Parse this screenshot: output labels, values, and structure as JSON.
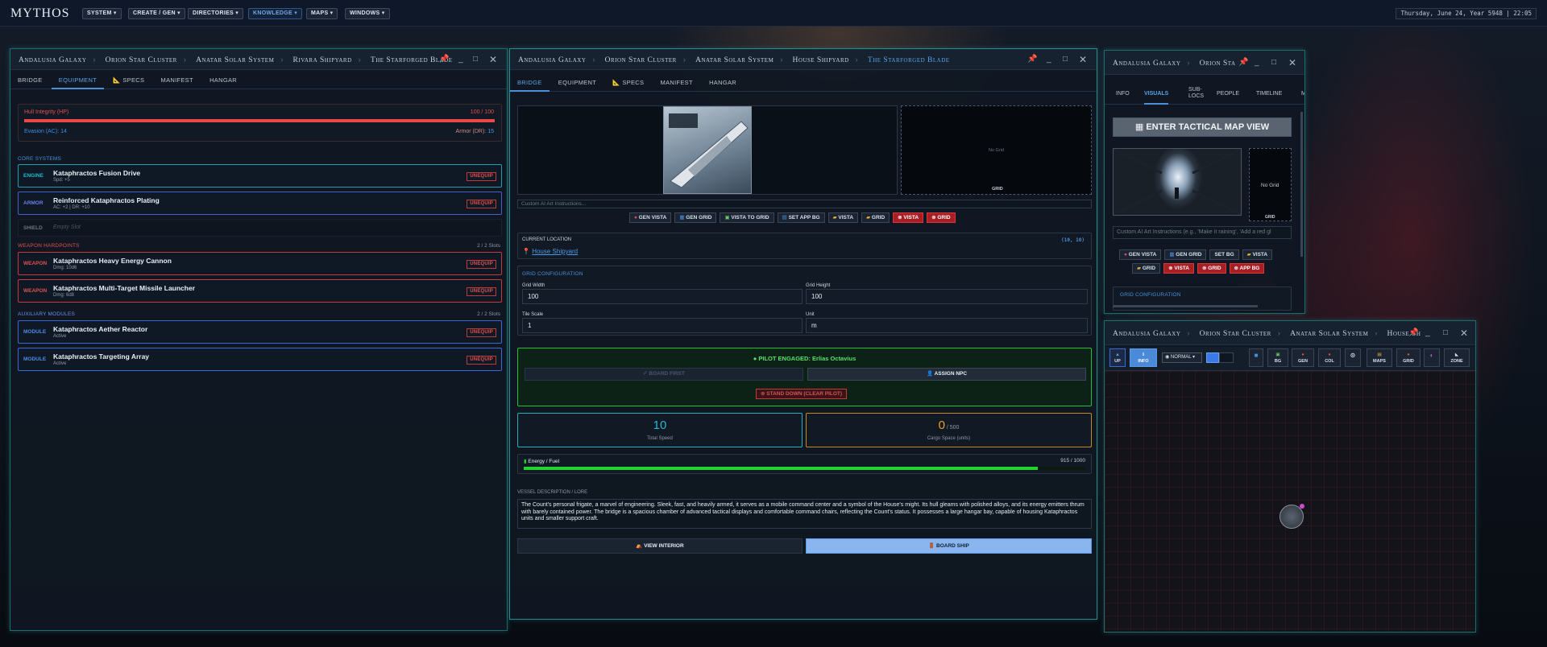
{
  "topbar": {
    "logo": "MYTHOS",
    "menus": [
      "SYSTEM ▾",
      "CREATE / GEN ▾",
      "DIRECTORIES ▾",
      "KNOWLEDGE ▾",
      "MAPS ▾",
      "WINDOWS ▾"
    ],
    "clock": "Thursday, June 24, Year 5948 | 22:05"
  },
  "win1": {
    "crumbs": [
      "Andalusia Galaxy",
      "Orion Star Cluster",
      "Anatar Solar System",
      "Rivara Shipyard",
      "The Starforged Blade"
    ],
    "tabs": [
      "BRIDGE",
      "EQUIPMENT",
      "SPECS",
      "MANIFEST",
      "HANGAR"
    ],
    "hull": {
      "label": "Hull Integrity (HP)",
      "value": "100 / 100",
      "fraction": 1.0
    },
    "evasion": "Evasion (AC): 14",
    "armor_label": "Armor (DR):",
    "armor_val": "15",
    "core_title": "CORE SYSTEMS",
    "core": [
      {
        "kind": "ENGINE",
        "name": "Kataphractos Fusion Drive",
        "stat": "Spd: +5",
        "btn": "UNEQUIP"
      },
      {
        "kind": "ARMOR",
        "name": "Reinforced Kataphractos Plating",
        "stat": "AC: +2 | DR: +10",
        "btn": "UNEQUIP"
      }
    ],
    "shield": {
      "kind": "SHIELD",
      "name": "Empty Slot"
    },
    "weapon_title": "WEAPON HARDPOINTS",
    "weapon_slots": "2 / 2 Slots",
    "weapons": [
      {
        "kind": "WEAPON",
        "name": "Kataphractos Heavy Energy Cannon",
        "stat": "Dmg: 10d6",
        "btn": "UNEQUIP"
      },
      {
        "kind": "WEAPON",
        "name": "Kataphractos Multi-Target Missile Launcher",
        "stat": "Dmg: 6d8",
        "btn": "UNEQUIP"
      }
    ],
    "aux_title": "AUXILIARY MODULES",
    "aux_slots": "2 / 2 Slots",
    "aux": [
      {
        "kind": "MODULE",
        "name": "Kataphractos Aether Reactor",
        "stat": "Active",
        "btn": "UNEQUIP"
      },
      {
        "kind": "MODULE",
        "name": "Kataphractos Targeting Array",
        "stat": "Active",
        "btn": "UNEQUIP"
      }
    ]
  },
  "win2": {
    "crumbs": [
      "Andalusia Galaxy",
      "Orion Star Cluster",
      "Anatar Solar System",
      "House Shipyard",
      "The Starforged Blade"
    ],
    "tabs": [
      "BRIDGE",
      "EQUIPMENT",
      "SPECS",
      "MANIFEST",
      "HANGAR"
    ],
    "no_grid": "No Grid",
    "grid_caption": "GRID",
    "art_placeholder": "Custom AI Art Instructions...",
    "buttons": [
      "GEN VISTA",
      "GEN GRID",
      "VISTA TO GRID",
      "SET APP BG",
      "VISTA",
      "GRID",
      "VISTA",
      "GRID"
    ],
    "loc_title": "CURRENT LOCATION",
    "loc_coords": "(10, 10)",
    "loc_name": "House Shipyard",
    "grid_title": "GRID CONFIGURATION",
    "gw_label": "Grid Width",
    "gw": "100",
    "gh_label": "Grid Height",
    "gh": "100",
    "ts_label": "Tile Scale",
    "ts": "1",
    "unit_label": "Unit",
    "unit": "m",
    "pilot": "PILOT ENGAGED: Erlias Octavius",
    "board_first": "BOARD FIRST",
    "assign": "ASSIGN NPC",
    "stand_down": "STAND DOWN (CLEAR PILOT)",
    "speed": "10",
    "speed_label": "Total Speed",
    "cargo": "0",
    "cargo_max": "/ 500",
    "cargo_label": "Cargo Space (units)",
    "energy_label": "Energy / Fuel",
    "energy_val": "915 / 1000",
    "energy_fraction": 0.915,
    "lore_title": "VESSEL DESCRIPTION / LORE",
    "lore": "The Count's personal frigate, a marvel of engineering. Sleek, fast, and heavily armed, it serves as a mobile command center and a symbol of the House's might. Its hull gleams with polished alloys, and its energy emitters thrum with barely contained power. The bridge is a spacious chamber of advanced tactical displays and comfortable command chairs, reflecting the Count's status. It possesses a large hangar bay, capable of housing Kataphractos units and smaller support craft.",
    "view_interior": "VIEW INTERIOR",
    "board_ship": "BOARD SHIP"
  },
  "win3": {
    "crumbs": [
      "Andalusia Galaxy",
      "Orion Sta"
    ],
    "tabs": [
      "INFO",
      "VISUALS",
      "SUB-",
      "PEOPLE",
      "TIMELINE",
      "M"
    ],
    "tab_sub2": "LOCS",
    "tactical": "ENTER TACTICAL MAP VIEW",
    "no_grid": "No Grid",
    "grid_caption": "GRID",
    "placeholder": "Custom AI Art Instructions (e.g., 'Make it raining', 'Add a red gl",
    "buttons1": [
      "GEN VISTA",
      "GEN GRID",
      "SET BG",
      "VISTA"
    ],
    "buttons2": [
      "GRID",
      "VISTA",
      "GRID",
      "APP BG"
    ],
    "grid_title": "GRID CONFIGURATION"
  },
  "win4": {
    "crumbs": [
      "Andalusia Galaxy",
      "Orion Star Cluster",
      "Anatar Solar System",
      "House Sh"
    ],
    "tools": [
      {
        "icon": "▲",
        "label": "UP"
      },
      {
        "icon": "ℹ",
        "label": "INFO"
      }
    ],
    "mode": "NORMAL",
    "tools2": [
      {
        "icon": "▣",
        "label": "BG"
      },
      {
        "icon": "●",
        "label": "GEN"
      },
      {
        "icon": "●",
        "label": "COL"
      },
      {
        "icon": "⊙",
        "label": ""
      },
      {
        "icon": "▤",
        "label": "MAPS"
      },
      {
        "icon": "●",
        "label": "GRID"
      },
      {
        "icon": "◐",
        "label": ""
      },
      {
        "icon": "◣",
        "label": "ZONE"
      }
    ]
  },
  "colors": {
    "accent": "#4a8fd8",
    "danger": "#e05050",
    "success": "#22cc33",
    "cargo": "#e8a020",
    "teal": "#22b0c0"
  }
}
